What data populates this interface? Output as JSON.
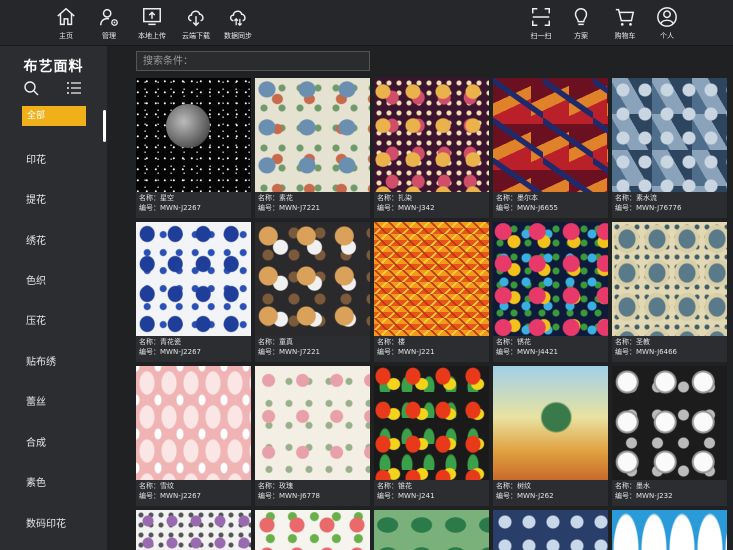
{
  "nav": [
    {
      "label": "主页",
      "icon": "home-icon"
    },
    {
      "label": "管理",
      "icon": "user-settings-icon"
    },
    {
      "label": "本地上传",
      "icon": "upload-icon"
    },
    {
      "label": "云端下载",
      "icon": "cloud-download-icon"
    },
    {
      "label": "数据同步",
      "icon": "cloud-sync-icon"
    },
    {
      "label": "扫一扫",
      "icon": "scan-icon"
    },
    {
      "label": "方案",
      "icon": "lightbulb-icon"
    },
    {
      "label": "购物车",
      "icon": "cart-icon"
    },
    {
      "label": "个人",
      "icon": "user-icon"
    }
  ],
  "sidebar": {
    "title": "布艺面料",
    "active": "全部",
    "categories": [
      "印花",
      "提花",
      "绣花",
      "色织",
      "压花",
      "贴布绣",
      "蕾丝",
      "合成",
      "素色",
      "数码印花"
    ]
  },
  "search": {
    "placeholder": "搜索条件："
  },
  "products": [
    {
      "name": "名称：星空",
      "code": "编号：MWN-J2267"
    },
    {
      "name": "名称：素花",
      "code": "编号：MWN-J7221"
    },
    {
      "name": "名称：扎染",
      "code": "编号：MWN-J342"
    },
    {
      "name": "名称：墨尔本",
      "code": "编号：MWN-J6655"
    },
    {
      "name": "名称：素水流",
      "code": "编号：MWN-J76776"
    },
    {
      "name": "名称：青花瓷",
      "code": "编号：MWN-J2267"
    },
    {
      "name": "名称：童真",
      "code": "编号：MWN-J7221"
    },
    {
      "name": "名称：楼",
      "code": "编号：MWN-J221"
    },
    {
      "name": "名称：锈花",
      "code": "编号：MWN-J4421"
    },
    {
      "name": "名称：圣教",
      "code": "编号：MWN-J6466"
    },
    {
      "name": "名称：雪纹",
      "code": "编号：MWN-J2267"
    },
    {
      "name": "名称：玫瑰",
      "code": "编号：MWN-J6778"
    },
    {
      "name": "名称：锥花",
      "code": "编号：MWN-J241"
    },
    {
      "name": "名称：树纹",
      "code": "编号：MWN-J262"
    },
    {
      "name": "名称：墨水",
      "code": "编号：MWN-J232"
    }
  ],
  "colors": {
    "accent": "#f0b019",
    "background": "#1f2123",
    "sidebar": "#2b2d30"
  }
}
